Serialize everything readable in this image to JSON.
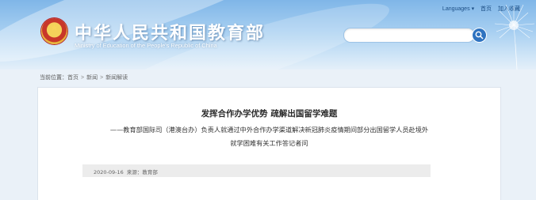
{
  "header": {
    "site_title": "中华人民共和国教育部",
    "site_subtitle": "Ministry of Education of the People's Republic of China",
    "links": {
      "languages": "Languages",
      "language_arrow": "▾",
      "home": "首页",
      "favorite": "加入收藏"
    },
    "search": {
      "placeholder": ""
    }
  },
  "breadcrumb": {
    "prefix": "当前位置：",
    "items": [
      "首页",
      "新闻",
      "新闻解读"
    ],
    "separator": ">"
  },
  "article": {
    "title": "发挥合作办学优势 疏解出国留学难题",
    "subtitle_line1": "——教育部国际司（港澳台办）负责人就通过中外合作办学渠道解决新冠肺炎疫情期间部分出国留学人员赴境外",
    "subtitle_line2": "就学困难有关工作答记者问",
    "date": "2020-09-16",
    "source_label": "来源：",
    "source": "教育部"
  },
  "colors": {
    "header_sky": "#7fb6e8",
    "search_button": "#2f73c0",
    "meta_bar": "#ececec"
  }
}
